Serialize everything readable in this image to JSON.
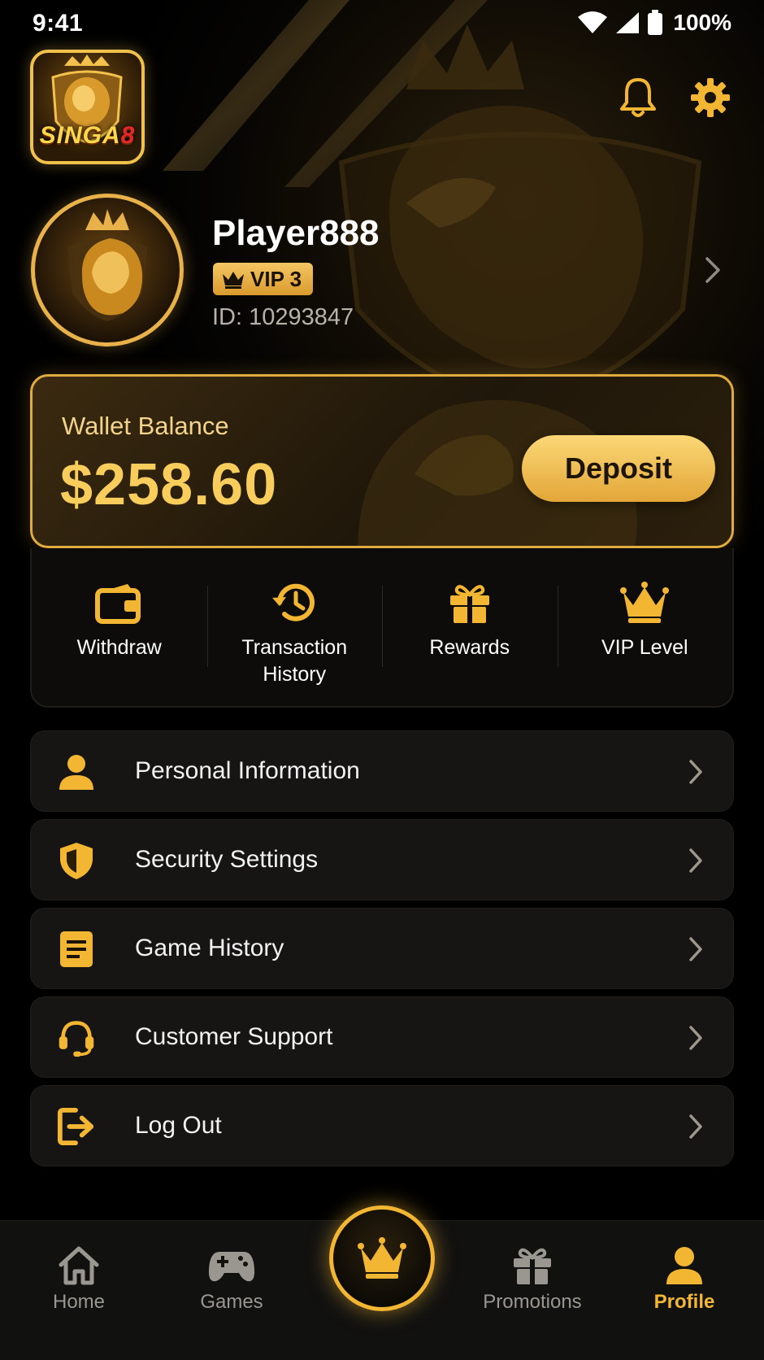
{
  "status_bar": {
    "time": "9:41",
    "battery": "100%"
  },
  "header": {
    "logo": {
      "text_main": "SINGA",
      "text_accent": "8"
    },
    "icons": [
      "bell-icon",
      "gear-icon"
    ]
  },
  "profile": {
    "username": "Player888",
    "vip_badge": "VIP 3",
    "user_id": "ID: 10293847"
  },
  "wallet": {
    "label": "Wallet Balance",
    "amount": "$258.60",
    "deposit_label": "Deposit"
  },
  "quick_actions": [
    {
      "label": "Withdraw",
      "icon": "wallet-icon"
    },
    {
      "label": "Transaction\nHistory",
      "icon": "history-icon"
    },
    {
      "label": "Rewards",
      "icon": "gift-icon"
    },
    {
      "label": "VIP Level",
      "icon": "crown-icon"
    }
  ],
  "menu": [
    {
      "label": "Personal Information",
      "icon": "user-icon"
    },
    {
      "label": "Security Settings",
      "icon": "shield-icon"
    },
    {
      "label": "Game History",
      "icon": "document-icon"
    },
    {
      "label": "Customer Support",
      "icon": "headset-icon"
    },
    {
      "label": "Log Out",
      "icon": "logout-icon"
    }
  ],
  "bottom_nav": {
    "items": [
      {
        "label": "Home",
        "icon": "home-icon"
      },
      {
        "label": "Games",
        "icon": "gamepad-icon"
      },
      {
        "label": "Promotions",
        "icon": "gift-icon"
      },
      {
        "label": "Profile",
        "icon": "user-icon"
      }
    ],
    "active": "Profile",
    "center_icon": "crown-icon"
  },
  "colors": {
    "accent_gold": "#f3b632",
    "amount_gold": "#f8cd5b",
    "card_bg": "#161513",
    "background": "#000000"
  }
}
